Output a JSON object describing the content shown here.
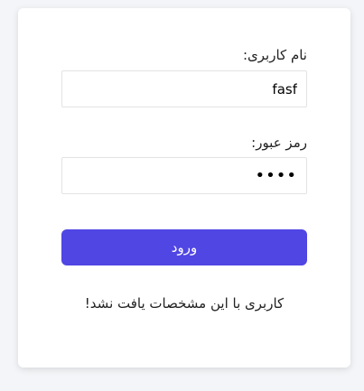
{
  "login_form": {
    "username_label": "نام کاربری:",
    "username_value": "fasf",
    "password_label": "رمز عبور:",
    "password_value": "••••",
    "submit_label": "ورود",
    "error_message": "کاربری با این مشخصات یافت نشد!"
  },
  "colors": {
    "page_background": "#f4f5f8",
    "card_background": "#ffffff",
    "button_background": "#5046e4",
    "button_text": "#ffffff"
  }
}
